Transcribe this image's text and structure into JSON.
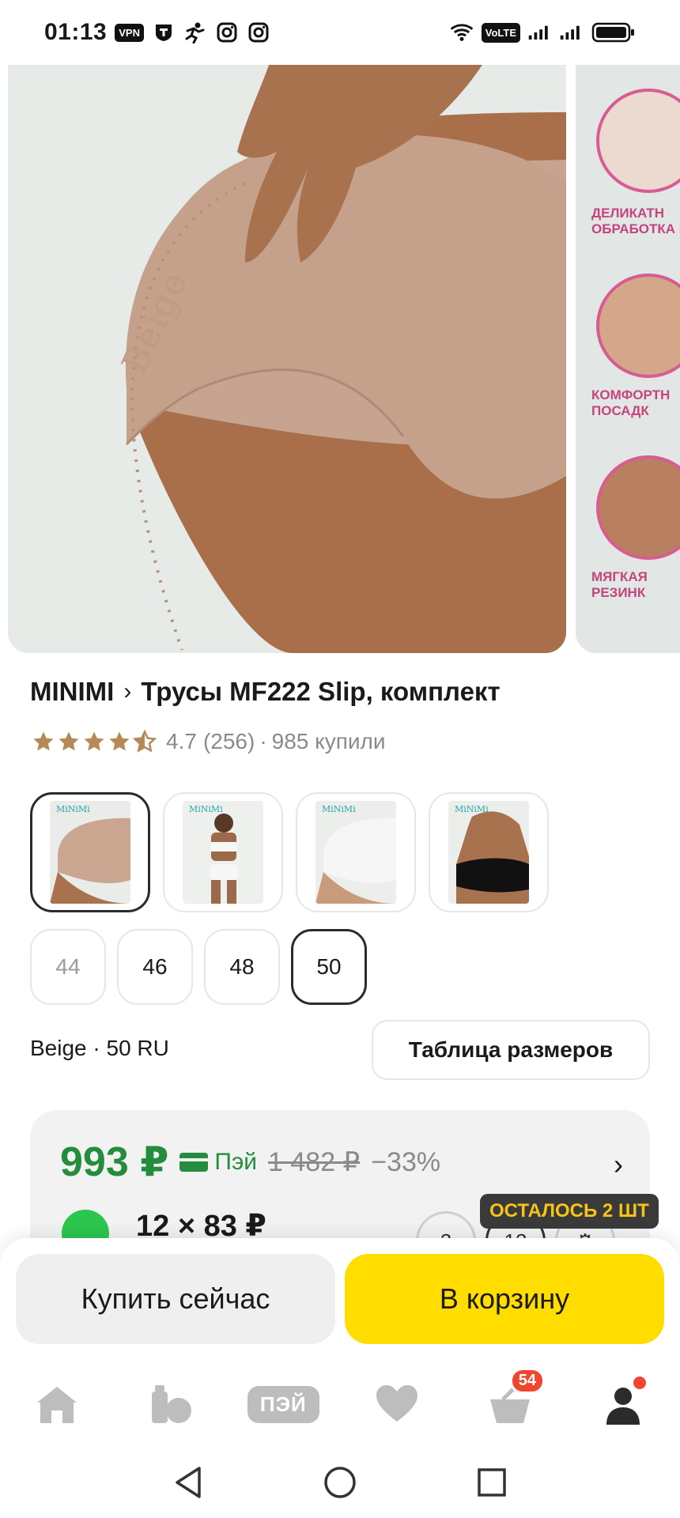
{
  "status_bar": {
    "time": "01:13",
    "vpn_label": "VPN",
    "volte_label": "VoLTE"
  },
  "gallery": {
    "main_photo_script_text": "Beige",
    "features": [
      "ДЕЛИКАТН ОБРАБОТКА К",
      "КОМФОРТН ПОСАДК",
      "МЯГКАЯ РЕЗИНК"
    ]
  },
  "product": {
    "brand": "MINIMI",
    "title": "Трусы MF222 Slip, комплект",
    "rating_value": "4.7",
    "reviews": "(256)",
    "separator": "·",
    "bought": "985 купили",
    "stars_filled": 4.5
  },
  "variants": [
    {
      "name": "beige",
      "selected": true,
      "colors": [
        "#e9ece8",
        "#caa690"
      ]
    },
    {
      "name": "white-model",
      "selected": false,
      "colors": [
        "#eef0ee",
        "#f7f7f7"
      ]
    },
    {
      "name": "white",
      "selected": false,
      "colors": [
        "#eceeec",
        "#f4f4f4"
      ]
    },
    {
      "name": "black",
      "selected": false,
      "colors": [
        "#eceeec",
        "#111111"
      ]
    }
  ],
  "sizes": [
    {
      "label": "44",
      "disabled": true
    },
    {
      "label": "46",
      "disabled": false
    },
    {
      "label": "48",
      "disabled": false
    },
    {
      "label": "50",
      "disabled": false,
      "selected": true
    }
  ],
  "selection": {
    "text": "Beige · 50 RU",
    "size_table_label": "Таблица размеров"
  },
  "price": {
    "current": "993 ₽",
    "pay_label": "Пэй",
    "old": "1 482 ₽",
    "discount": "−33%",
    "installment": "12 × 83 ₽",
    "option_1": "2",
    "option_2": "12",
    "stock_badge": "ОСТАЛОСЬ 2 ШТ"
  },
  "actions": {
    "buy_now": "Купить сейчас",
    "to_cart": "В корзину"
  },
  "tabbar": {
    "pay_label": "ПЭЙ",
    "cart_count": "54"
  },
  "colors": {
    "price_green": "#238c3d",
    "cart_yellow": "#ffdd00",
    "badge_red": "#f0462f",
    "feature_pink": "#c4457b"
  }
}
